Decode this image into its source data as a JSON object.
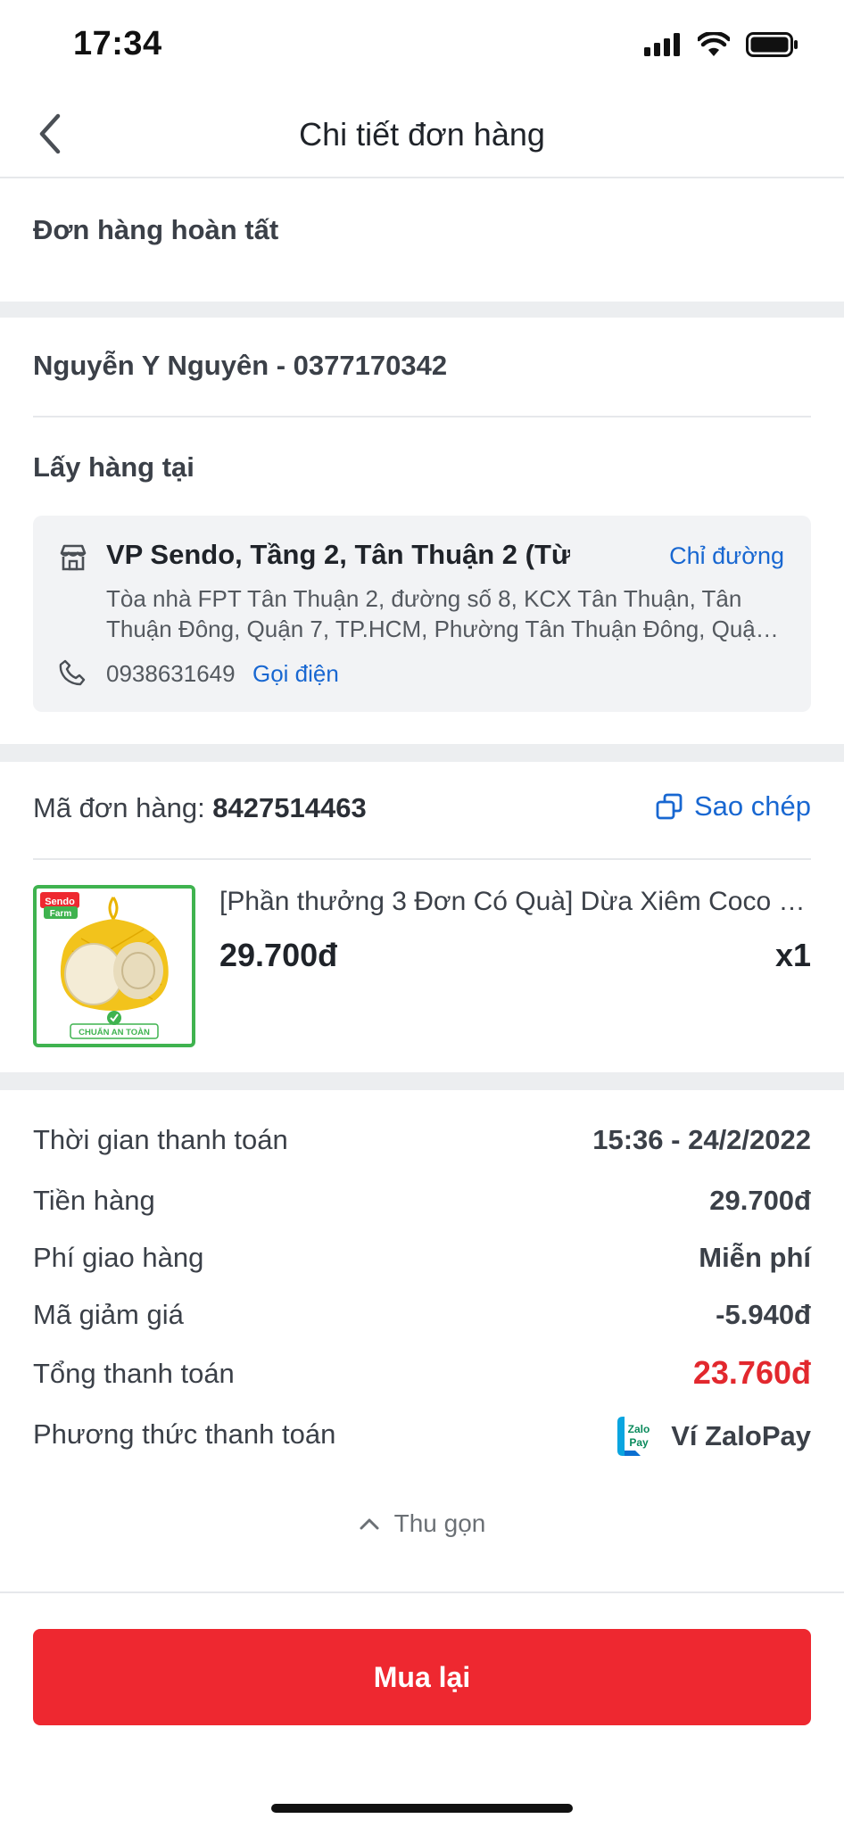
{
  "status_bar": {
    "time": "17:34"
  },
  "nav": {
    "title": "Chi tiết đơn hàng"
  },
  "order_status": "Đơn hàng hoàn tất",
  "customer": {
    "name_phone": "Nguyễn Y Nguyên - 0377170342"
  },
  "pickup": {
    "label": "Lấy hàng tại",
    "store_name": "VP Sendo, Tầng 2, Tân Thuận 2 (Từ",
    "directions_label": "Chỉ đường",
    "address": "Tòa nhà FPT Tân Thuận 2, đường số 8, KCX Tân Thuận, Tân Thuận Đông, Quận 7, TP.HCM, Phường Tân Thuận Đông, Quận 7",
    "phone": "0938631649",
    "call_label": "Gọi điện"
  },
  "order": {
    "code_label": "Mã đơn hàng: ",
    "code": "8427514463",
    "copy_label": "Sao chép",
    "product": {
      "name": "[Phần thưởng 3 Đơn Có Quà] Dừa Xiêm Coco …",
      "price": "29.700đ",
      "qty": "x1",
      "badge_brand": "Sendo",
      "badge_sub": "Farm",
      "badge_safe": "CHUẨN AN TOÀN"
    }
  },
  "payment": {
    "rows": [
      {
        "label": "Thời gian thanh toán",
        "value": "15:36 - 24/2/2022"
      },
      {
        "label": "Tiền hàng",
        "value": "29.700đ"
      },
      {
        "label": "Phí giao hàng",
        "value": "Miễn phí"
      },
      {
        "label": "Mã giảm giá",
        "value": "-5.940đ"
      },
      {
        "label": "Tổng thanh toán",
        "value": "23.760đ"
      },
      {
        "label": "Phương thức thanh toán",
        "value": "Ví ZaloPay"
      }
    ],
    "zalo_logo_top": "Zalo",
    "zalo_logo_bottom": "Pay",
    "collapse_label": "Thu gọn",
    "total_color": "#e2282e"
  },
  "actions": {
    "buy_again": "Mua lại",
    "button_color": "#ee2830"
  }
}
